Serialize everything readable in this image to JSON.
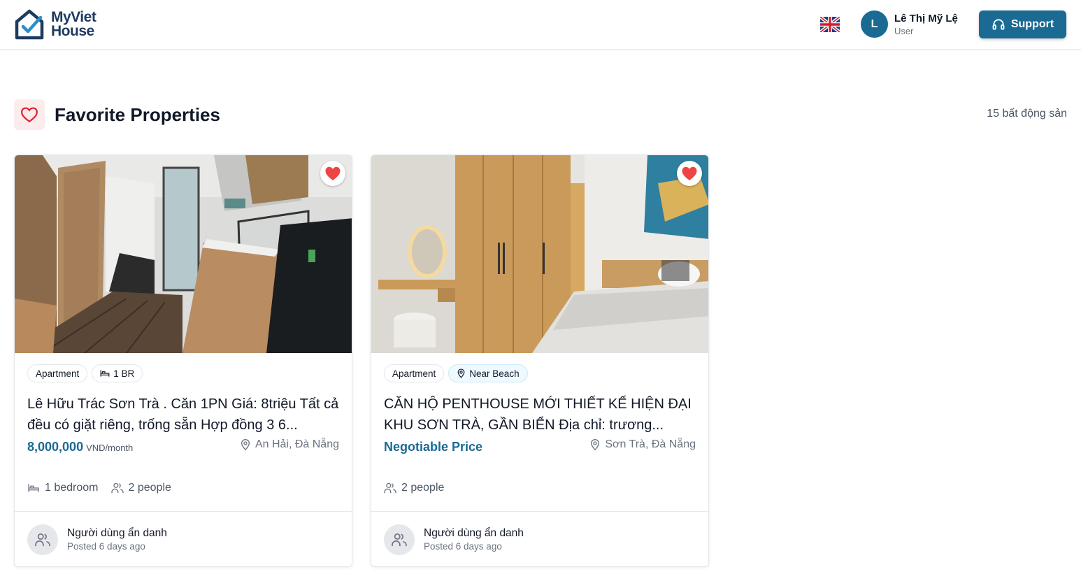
{
  "header": {
    "logo": {
      "line1": "MyViet",
      "line2": "House"
    },
    "language_icon": "uk-flag-icon",
    "user": {
      "initial": "L",
      "name": "Lê Thị Mỹ Lệ",
      "role": "User"
    },
    "support_label": "Support"
  },
  "section": {
    "title": "Favorite Properties",
    "count": "15 bất động sản"
  },
  "cards": [
    {
      "tags": [
        "Apartment",
        "1 BR"
      ],
      "title": "Lê Hữu Trác Sơn Trà . Căn 1PN Giá: 8triệu Tất cả đều có giặt riêng, trống sẵn Hợp đồng 3 6...",
      "price": "8,000,000",
      "price_unit": "VND/month",
      "location": "An Hải, Đà Nẵng",
      "features": [
        "1 bedroom",
        "2 people"
      ],
      "poster": "Người dùng ẩn danh",
      "posted": "Posted 6 days ago",
      "favorited": true
    },
    {
      "tags": [
        "Apartment",
        "Near Beach"
      ],
      "title": "CĂN HỘ PENTHOUSE MỚI THIẾT KẾ HIỆN ĐẠI KHU SƠN TRÀ, GẦN BIỂN Địa chỉ: trương...",
      "price": "Negotiable Price",
      "price_unit": "",
      "location": "Sơn Trà, Đà Nẵng",
      "features": [
        "2 people"
      ],
      "poster": "Người dùng ẩn danh",
      "posted": "Posted 6 days ago",
      "favorited": true
    }
  ],
  "colors": {
    "brand": "#1b6a93",
    "heart": "#ef4444",
    "logo_text": "#1e3a5f"
  }
}
